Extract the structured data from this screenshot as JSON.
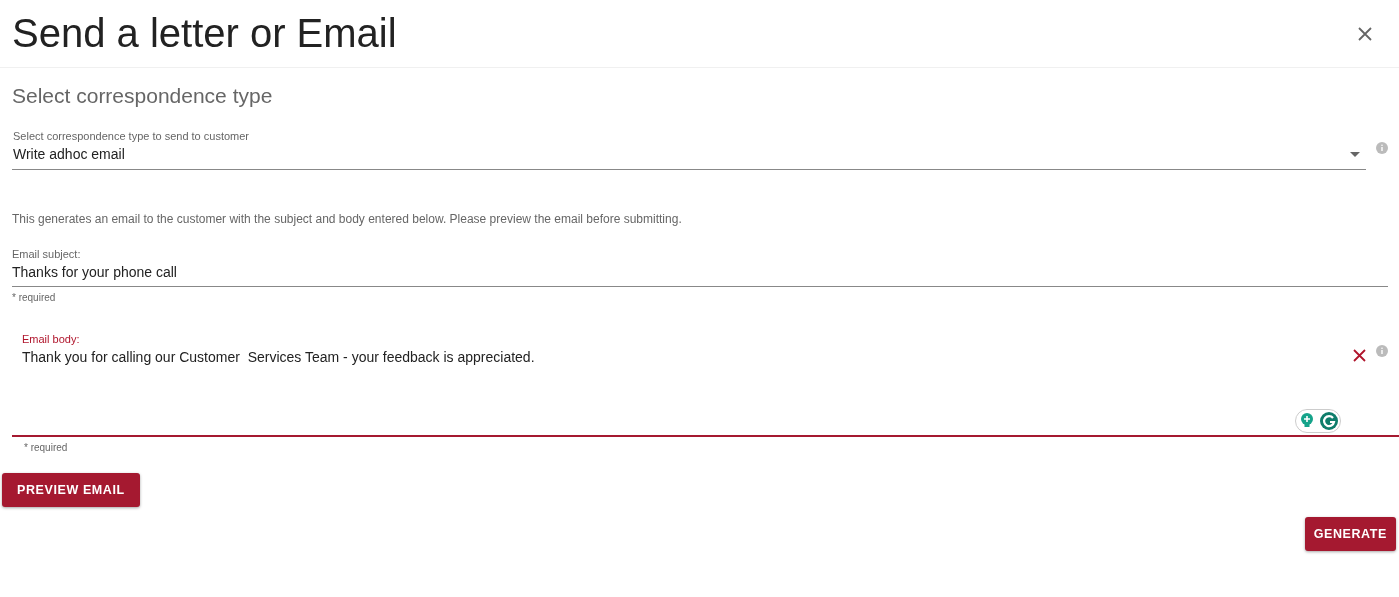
{
  "dialog": {
    "title": "Send a letter or Email",
    "section_title": "Select correspondence type"
  },
  "type_select": {
    "label": "Select correspondence type to send to customer",
    "value": "Write adhoc email"
  },
  "description": "This generates an email to the customer with the subject and body entered below. Please preview the email before submitting.",
  "subject": {
    "label": "Email subject:",
    "value": "Thanks for your phone call",
    "hint": "* required",
    "focused": false
  },
  "body": {
    "label": "Email body:",
    "value": "Thank you for calling our Customer  Services Team - your feedback is appreciated.",
    "hint": "* required",
    "focused": true
  },
  "buttons": [
    {
      "label": "PREVIEW EMAIL",
      "kind": "preview"
    },
    {
      "label": "GENERATE",
      "kind": "generate"
    }
  ]
}
